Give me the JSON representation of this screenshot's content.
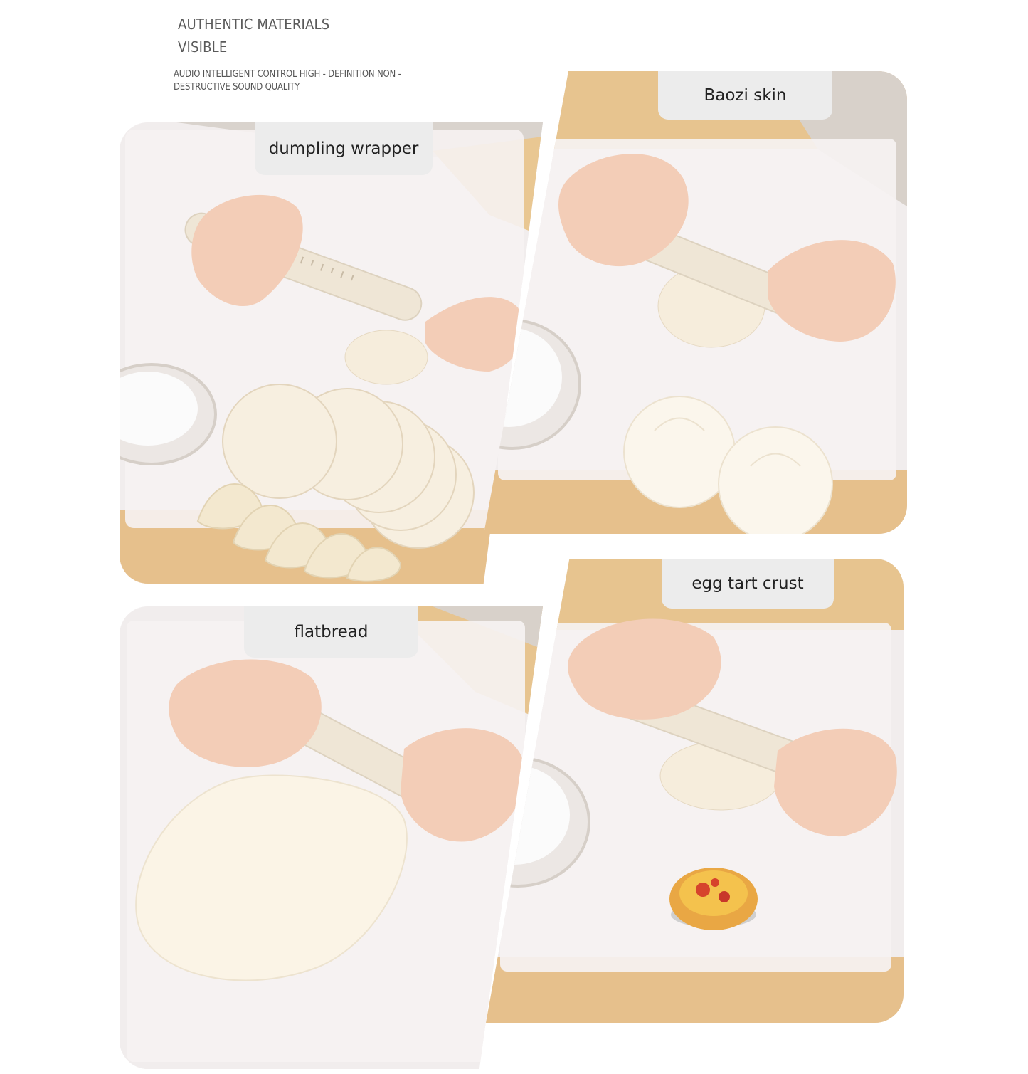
{
  "header": {
    "title_line1": "AUTHENTIC MATERIALS",
    "title_line2": "VISIBLE",
    "subtitle_line1": "AUDIO INTELLIGENT CONTROL HIGH - DEFINITION NON -",
    "subtitle_line2": "DESTRUCTIVE SOUND QUALITY"
  },
  "panels": [
    {
      "label": "dumpling wrapper"
    },
    {
      "label": "Baozi skin"
    },
    {
      "label": "flatbread"
    },
    {
      "label": "egg tart crust"
    }
  ],
  "colors": {
    "mat": "#f3efef",
    "wood": "#e7c48f",
    "label_bg": "#ececec",
    "dough": "#f6eddc",
    "pin": "#efe6d6",
    "skin": "#f3cdb7"
  }
}
